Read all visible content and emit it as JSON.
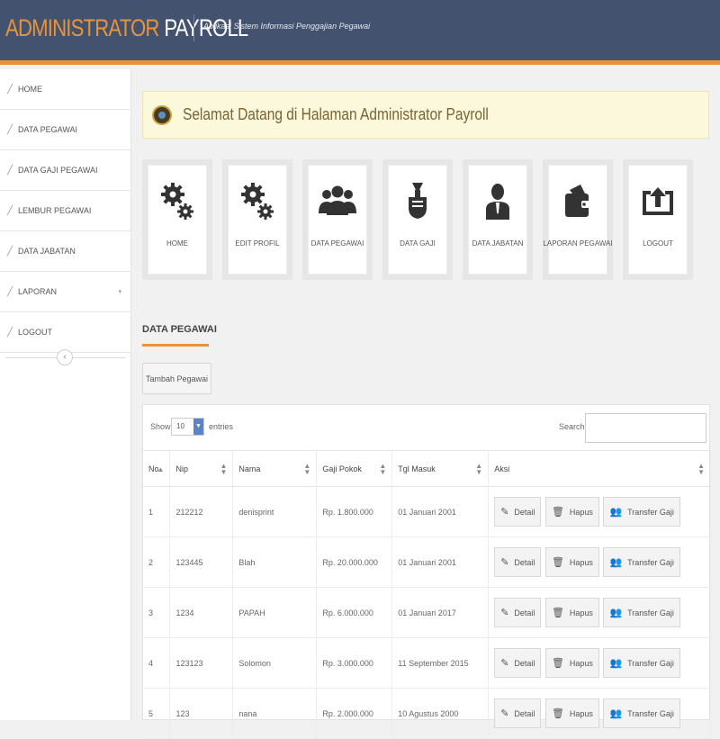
{
  "header": {
    "brand_part1": "ADMINISTRATOR",
    "brand_part2": "PAYROLL",
    "tagline": "Aplikasi Sistem Informasi Penggajian Pegawai",
    "bg_color": "#43536f",
    "accent_color": "#e8933a"
  },
  "sidebar": {
    "items": [
      {
        "label": "HOME",
        "icon": "pencil-icon"
      },
      {
        "label": "DATA PEGAWAI",
        "icon": "pencil-icon"
      },
      {
        "label": "DATA GAJI PEGAWAI",
        "icon": "pencil-icon"
      },
      {
        "label": "LEMBUR PEGAWAI",
        "icon": "pencil-icon"
      },
      {
        "label": "DATA JABATAN",
        "icon": "pencil-icon"
      },
      {
        "label": "LAPORAN",
        "icon": "pencil-icon",
        "caret": "▾"
      },
      {
        "label": "LOGOUT",
        "icon": "pencil-icon"
      }
    ],
    "collapse_glyph": "‹"
  },
  "welcome": {
    "text": "Selamat Datang di Halaman Administrator Payroll"
  },
  "tiles": [
    {
      "label": "HOME",
      "icon": "gears-icon"
    },
    {
      "label": "EDIT PROFIL",
      "icon": "gears-icon"
    },
    {
      "label": "DATA PEGAWAI",
      "icon": "users-icon"
    },
    {
      "label": "DATA GAJI",
      "icon": "money-hand-icon"
    },
    {
      "label": "DATA JABATAN",
      "icon": "user-suit-icon"
    },
    {
      "label": "LAPORAN PEGAWAI",
      "icon": "wallet-icon"
    },
    {
      "label": "LOGOUT",
      "icon": "export-icon"
    }
  ],
  "section": {
    "title": "DATA PEGAWAI",
    "add_button": "Tambah Pegawai"
  },
  "table": {
    "show_label": "Show",
    "page_size": "10",
    "entries_label": "entries",
    "search_label": "Search:",
    "search_value": "",
    "columns": [
      "No",
      "Nip",
      "Nama",
      "Gaji Pokok",
      "Tgl Masuk",
      "Aksi"
    ],
    "rows": [
      {
        "no": "1",
        "nip": "212212",
        "nama": "denisprint",
        "gaji": "Rp. 1.800.000",
        "tgl": "01 Januari 2001"
      },
      {
        "no": "2",
        "nip": "123445",
        "nama": "Blah",
        "gaji": "Rp. 20.000.000",
        "tgl": "01 Januari 2001"
      },
      {
        "no": "3",
        "nip": "1234",
        "nama": "PAPAH",
        "gaji": "Rp. 6.000.000",
        "tgl": "01 Januari 2017"
      },
      {
        "no": "4",
        "nip": "123123",
        "nama": "Solomon",
        "gaji": "Rp. 3.000.000",
        "tgl": "11 September 2015"
      },
      {
        "no": "5",
        "nip": "123",
        "nama": "nana",
        "gaji": "Rp. 2.000.000",
        "tgl": "10 Agustus 2000"
      }
    ],
    "actions": {
      "detail": "Detail",
      "hapus": "Hapus",
      "transfer": "Transfer Gaji"
    }
  }
}
